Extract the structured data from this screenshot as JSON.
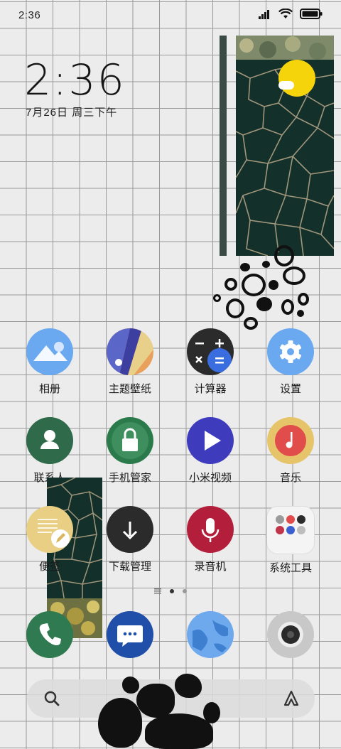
{
  "status_bar": {
    "time": "2:36"
  },
  "lock": {
    "clock": "2:36",
    "date": "7月26日 周三下午"
  },
  "apps": [
    {
      "label": "相册",
      "icon": "gallery-icon"
    },
    {
      "label": "主题壁纸",
      "icon": "themes-icon"
    },
    {
      "label": "计算器",
      "icon": "calculator-icon"
    },
    {
      "label": "设置",
      "icon": "settings-icon"
    },
    {
      "label": "联系人",
      "icon": "contacts-icon"
    },
    {
      "label": "手机管家",
      "icon": "security-icon"
    },
    {
      "label": "小米视频",
      "icon": "video-icon"
    },
    {
      "label": "音乐",
      "icon": "music-icon"
    },
    {
      "label": "便签",
      "icon": "notes-icon"
    },
    {
      "label": "下载管理",
      "icon": "downloads-icon"
    },
    {
      "label": "录音机",
      "icon": "recorder-icon"
    },
    {
      "label": "系统工具",
      "icon": "system-tools-folder-icon"
    }
  ],
  "dock": [
    {
      "icon": "phone-icon"
    },
    {
      "icon": "messages-icon"
    },
    {
      "icon": "browser-icon"
    },
    {
      "icon": "camera-icon"
    }
  ],
  "colors": {
    "gallery": "#6aa8f0",
    "contacts": "#2f6a4a",
    "security": "#2b7a4b",
    "video": "#3e3bbd",
    "music_bg": "#e6c46a",
    "music_fg": "#e04d4b",
    "downloads": "#2b2b2b",
    "recorder": "#b31f3a",
    "phone": "#2f7a50",
    "messages": "#1f4fa8",
    "browser": "#6ea9ee",
    "camera": "#c8c8c8",
    "sun": "#f5d40b"
  }
}
